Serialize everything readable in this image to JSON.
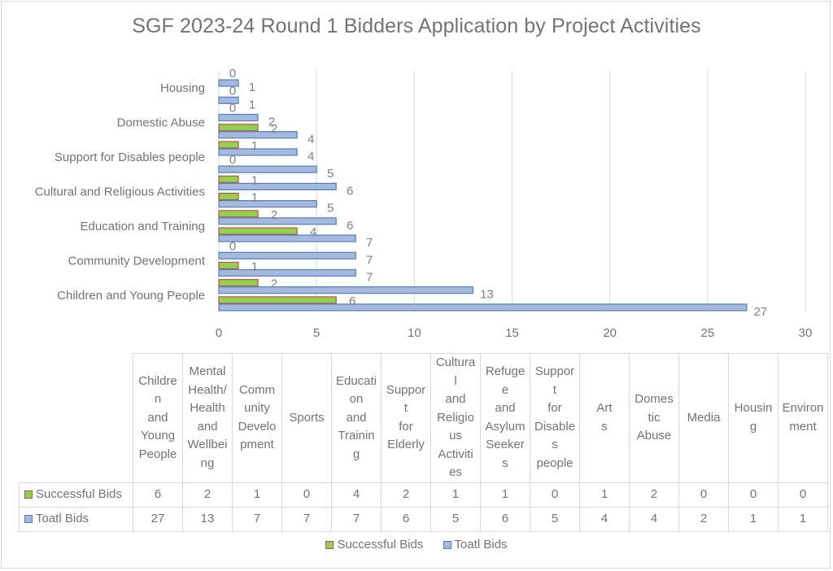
{
  "chart_data": {
    "type": "bar",
    "orientation": "horizontal",
    "title": "SGF 2023-24 Round 1 Bidders Application by Project Activities",
    "xlabel": "",
    "ylabel": "",
    "xlim": [
      0,
      30
    ],
    "x_ticks": [
      0,
      5,
      10,
      15,
      20,
      25,
      30
    ],
    "grid": "vertical",
    "legend_position": "bottom",
    "categories": [
      "Children and Young People",
      "Mental Health/ Health and Wellbeing",
      "Community Development",
      "Sports",
      "Education and Training",
      "Support for Elderly",
      "Cultural and Religious Activities",
      "Refugee and Asylum Seekers",
      "Support for Disables people",
      "Art s",
      "Domestic Abuse",
      "Media",
      "Housing",
      "Environment"
    ],
    "axis_labels_shown": [
      "Children and Young People",
      "",
      "Community Development",
      "",
      "Education and Training",
      "",
      "Cultural and Religious Activities",
      "",
      "Support for Disables people",
      "",
      "Domestic Abuse",
      "",
      "Housing",
      ""
    ],
    "table_headers": [
      "Childre n and Young People",
      "Mental Health/ Health and Wellbei ng",
      "Comm unity Develo pment",
      "Sports",
      "Educati on and Trainin g",
      "Suppor t for Elderly",
      "Cultura l and Religio us Activiti es",
      "Refuge e and Asylum Seeker s",
      "Suppor t for Disable s people",
      "Art s",
      "Domes tic Abuse",
      "Media",
      "Housin g",
      "Environ ment"
    ],
    "series": [
      {
        "name": "Successful Bids",
        "color": "#92d050",
        "border": "#c0504d",
        "values": [
          6,
          2,
          1,
          0,
          4,
          2,
          1,
          1,
          0,
          1,
          2,
          0,
          0,
          0
        ]
      },
      {
        "name": "Toatl Bids",
        "color": "#a6b8db",
        "border": "#4f81bd",
        "values": [
          27,
          13,
          7,
          7,
          7,
          6,
          5,
          6,
          5,
          4,
          4,
          2,
          1,
          1
        ]
      }
    ]
  }
}
